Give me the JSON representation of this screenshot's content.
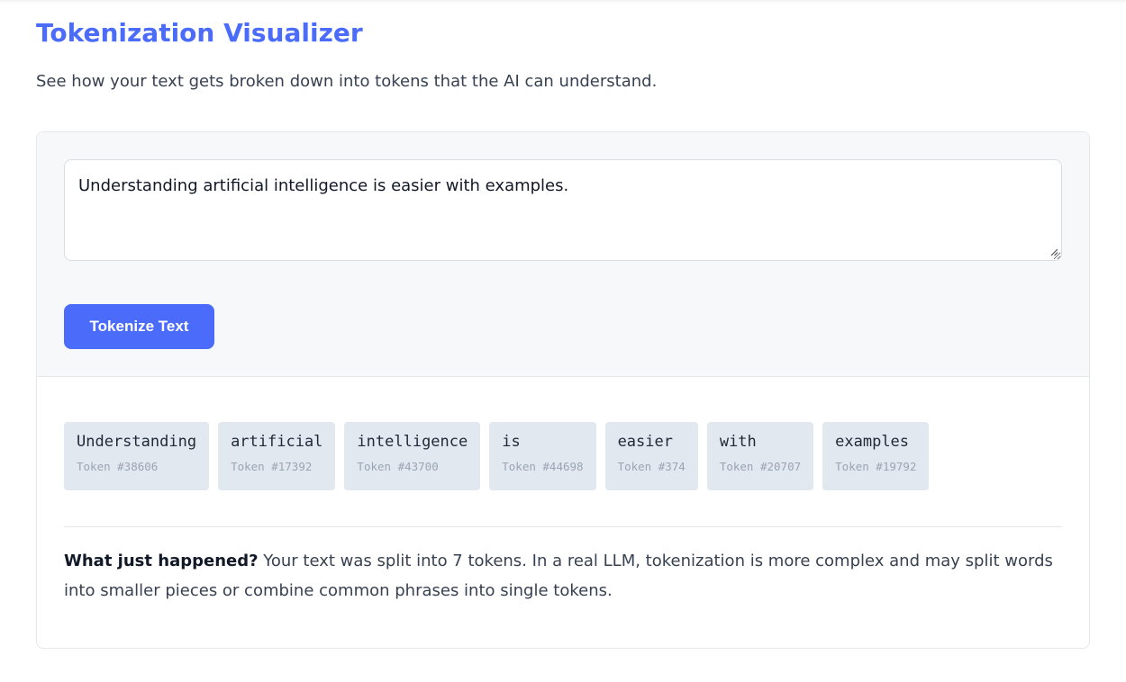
{
  "header": {
    "title": "Tokenization Visualizer",
    "subtitle": "See how your text gets broken down into tokens that the AI can understand."
  },
  "input": {
    "value": "Understanding artificial intelligence is easier with examples."
  },
  "tokenize_button": {
    "label": "Tokenize Text"
  },
  "tokens": [
    {
      "text": "Understanding",
      "id": "Token #38606"
    },
    {
      "text": "artificial",
      "id": "Token #17392"
    },
    {
      "text": "intelligence",
      "id": "Token #43700"
    },
    {
      "text": "is",
      "id": "Token #44698"
    },
    {
      "text": "easier",
      "id": "Token #374"
    },
    {
      "text": "with",
      "id": "Token #20707"
    },
    {
      "text": "examples",
      "id": "Token #19792"
    }
  ],
  "explanation": {
    "heading": "What just happened?",
    "body": " Your text was split into 7 tokens. In a real LLM, tokenization is more complex and may split words into smaller pieces or combine common phrases into single tokens."
  },
  "colors": {
    "accent": "#4b6bfb",
    "token_bg": "#e2e8f0",
    "panel_bg": "#f7f8fa"
  }
}
